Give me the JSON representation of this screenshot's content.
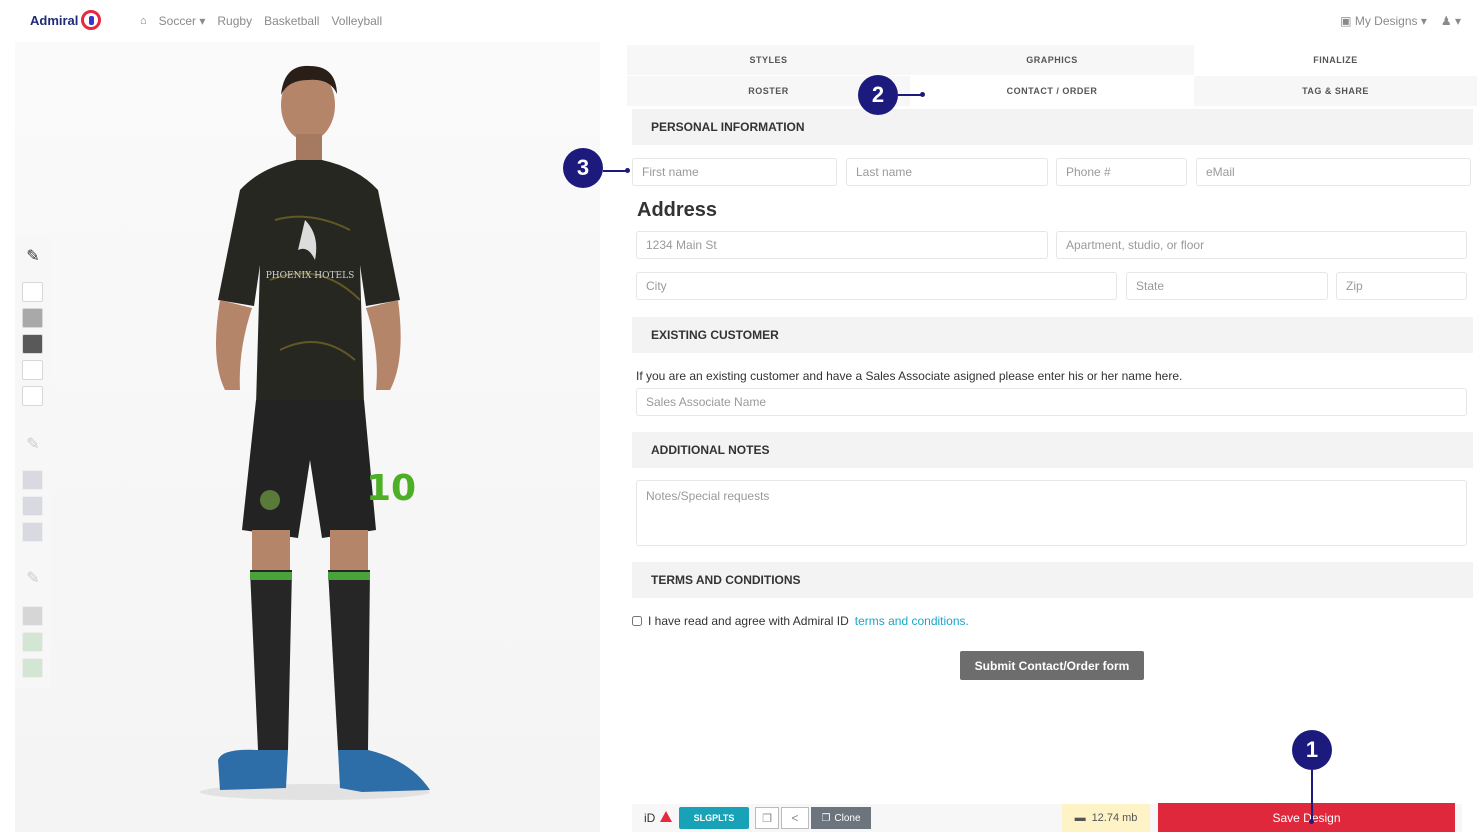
{
  "header": {
    "brand": "Admiral",
    "nav": [
      "Soccer",
      "Rugby",
      "Basketball",
      "Volleyball"
    ],
    "my_designs": "My Designs"
  },
  "tabs": {
    "styles": "STYLES",
    "graphics": "GRAPHICS",
    "finalize": "FINALIZE",
    "roster": "ROSTER",
    "contact_order": "CONTACT / ORDER",
    "tag_share": "TAG & SHARE"
  },
  "jersey": {
    "sponsor": "PHOENIX HOTELS",
    "number": "10"
  },
  "form": {
    "personal_info": "PERSONAL INFORMATION",
    "first_name": "First name",
    "last_name": "Last name",
    "phone": "Phone #",
    "email": "eMail",
    "address_title": "Address",
    "address1": "1234 Main St",
    "address2": "Apartment, studio, or floor",
    "city": "City",
    "state": "State",
    "zip": "Zip",
    "existing_customer": "EXISTING CUSTOMER",
    "existing_text": "If you are an existing customer and have a Sales Associate asigned please enter his or her name here.",
    "sales_associate": "Sales Associate Name",
    "additional_notes": "ADDITIONAL NOTES",
    "notes_placeholder": "Notes/Special requests",
    "terms_heading": "TERMS AND CONDITIONS",
    "terms_text": "I have read and agree with  Admiral ID",
    "terms_link": "terms and conditions.",
    "submit": "Submit Contact/Order form"
  },
  "bottom": {
    "id_label": "iD",
    "slug": "SLGPLTS",
    "clone": "Clone",
    "size": "12.74 mb",
    "save": "Save Design"
  },
  "callouts": {
    "c1": "1",
    "c2": "2",
    "c3": "3"
  },
  "colors": {
    "accent_red": "#e0283c",
    "callout_navy": "#1d1a7e",
    "teal": "#17a2b8"
  }
}
